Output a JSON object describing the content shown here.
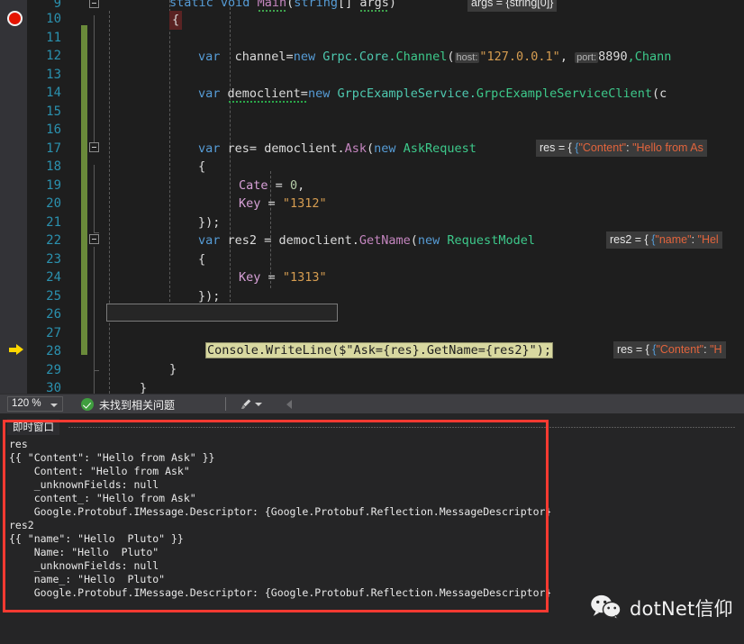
{
  "editor": {
    "zoom_level": "120 %",
    "line_numbers": [
      9,
      10,
      11,
      12,
      13,
      14,
      15,
      16,
      17,
      18,
      19,
      20,
      21,
      22,
      23,
      24,
      25,
      26,
      27,
      28,
      29,
      30
    ],
    "breakpoint_line": 10,
    "current_execution_line": 28,
    "lines": {
      "l9": {
        "kw1": "static",
        "kw2": "void",
        "method": "Main",
        "kw3": "string",
        "brackets": "[] ",
        "arg": "args",
        "open": "(",
        "close": ")"
      },
      "l10": {
        "brace": "{"
      },
      "l12": {
        "kw": "var",
        "name": "channel=",
        "newkw": "new",
        "ns": "Grpc.Core.",
        "type": "Channel",
        "p1": "host:",
        "v1": "\"127.0.0.1\"",
        "p2": "port:",
        "v2": "8890",
        "tail": ",Chann"
      },
      "l14": {
        "kw": "var",
        "name": "democlient=",
        "newkw": "new",
        "ns": "GrpcExampleService.",
        "type": "GrpcExampleServiceClient",
        "tail": "(c"
      },
      "l17": {
        "kw": "var",
        "name": "res=",
        "obj": "democlient.",
        "method": "Ask",
        "open": "(",
        "newkw": "new",
        "type": "AskRequest"
      },
      "l18": {
        "brace": "{"
      },
      "l19": {
        "prop": "Cate",
        "eq": "=",
        "val": "0",
        "comma": ","
      },
      "l20": {
        "prop": "Key",
        "eq": "=",
        "val": "\"1312\""
      },
      "l21": {
        "close": "});"
      },
      "l22": {
        "kw": "var",
        "name": "res2 = ",
        "obj": "democlient.",
        "method": "GetName",
        "open": "(",
        "newkw": "new",
        "type": "RequestModel"
      },
      "l23": {
        "brace": "{"
      },
      "l24": {
        "prop": "Key",
        "eq": "=",
        "val": "\"1313\""
      },
      "l25": {
        "close": "});"
      },
      "l28": {
        "text": "Console.WriteLine($\"Ask={res}.GetName={res2}\");"
      },
      "l29": {
        "brace": "}"
      },
      "l30": {
        "brace": "}"
      }
    },
    "datatips": [
      {
        "id": "args",
        "text": "args = {string[0]}"
      },
      {
        "id": "res17",
        "label": "res = { ",
        "key": "\"Content\"",
        "sep": ": ",
        "value": "\"Hello from As"
      },
      {
        "id": "res22",
        "label": "res2 = { ",
        "key": "\"name\"",
        "sep": ": ",
        "value": "\"Hel"
      },
      {
        "id": "res28",
        "label": "res = { ",
        "key": "\"Content\"",
        "sep": ": ",
        "value": "\"H"
      }
    ]
  },
  "statusbar": {
    "zoom": "120 %",
    "issues_text": "未找到相关问题",
    "ok_icon": "check-circle-icon",
    "brush_icon": "brush-icon",
    "collapse_icon": "caret-left-icon"
  },
  "immediate_window": {
    "tab_label": "即时窗口",
    "content": "res\n{{ \"Content\": \"Hello from Ask\" }}\n    Content: \"Hello from Ask\"\n    _unknownFields: null\n    content_: \"Hello from Ask\"\n    Google.Protobuf.IMessage.Descriptor: {Google.Protobuf.Reflection.MessageDescriptor}\nres2\n{{ \"name\": \"Hello  Pluto\" }}\n    Name: \"Hello  Pluto\"\n    _unknownFields: null\n    name_: \"Hello  Pluto\"\n    Google.Protobuf.IMessage.Descriptor: {Google.Protobuf.Reflection.MessageDescriptor}",
    "annotation_color": "#f93a31"
  },
  "watermark": {
    "icon": "wechat-icon",
    "text": "dotNet信仰"
  },
  "colors": {
    "editor_bg": "#1e1e1e",
    "panel_bg": "#252526",
    "statusbar_bg": "#3e3e42",
    "line_number": "#2b91af",
    "keyword": "#569cd6",
    "type": "#4ec9b0",
    "string": "#d69d51",
    "method": "#c586c0",
    "breakpoint": "#e51400",
    "exec_arrow": "#ffd700",
    "exec_highlight": "#d8d8a0",
    "changebar": "#6a8a3a",
    "annotation": "#f93a31"
  }
}
